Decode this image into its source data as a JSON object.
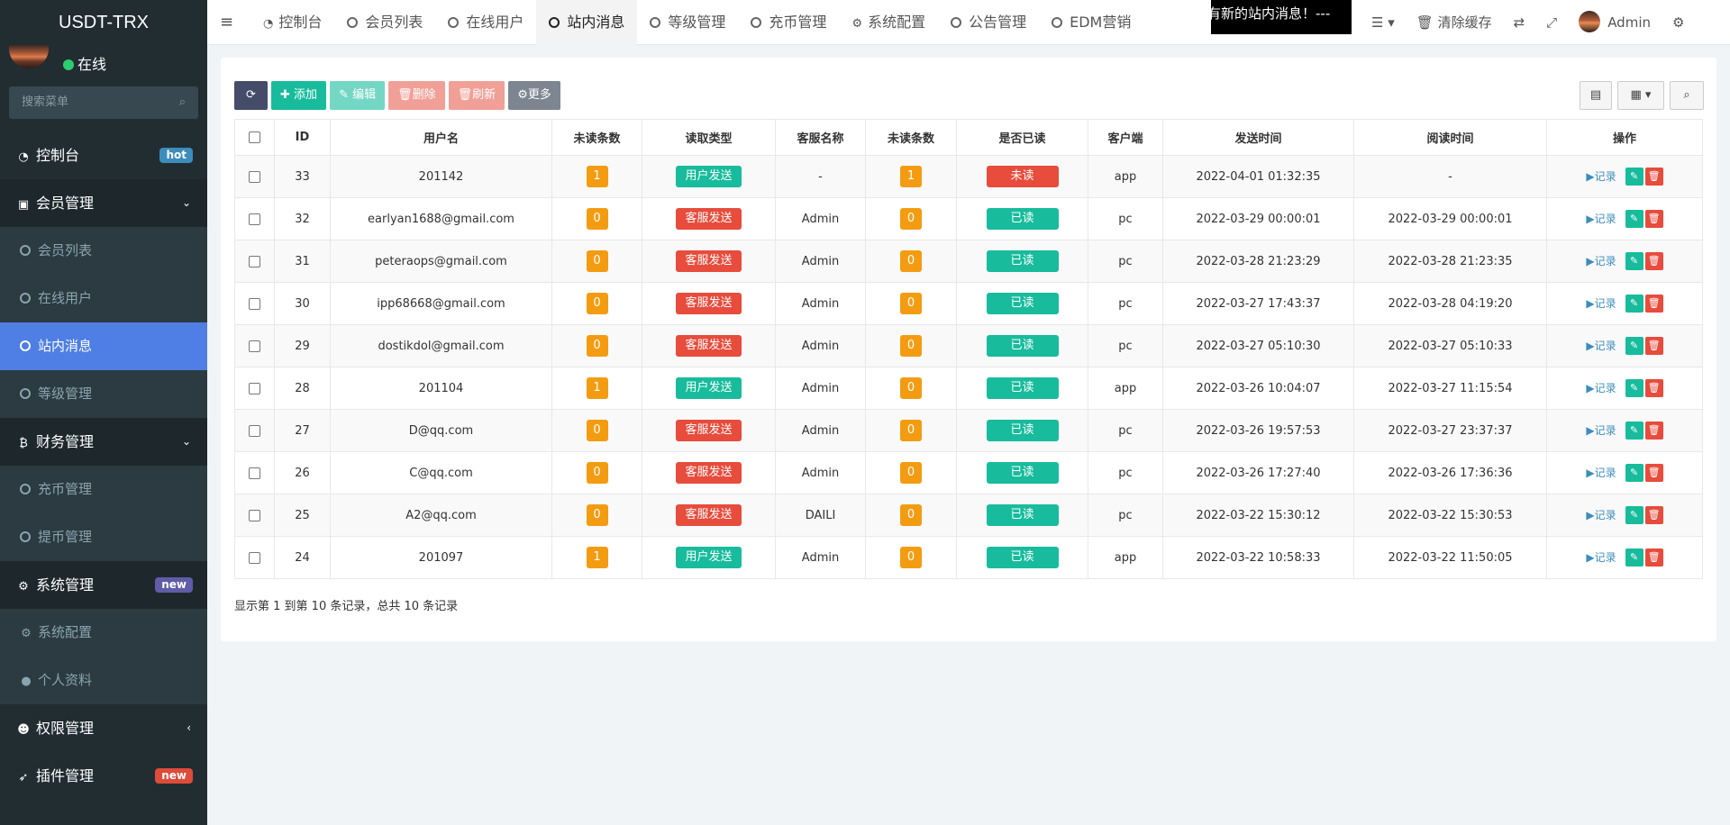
{
  "brand": "USDT-TRX",
  "user": {
    "status": "在线"
  },
  "search": {
    "placeholder": "搜索菜单",
    "icon": "search-icon"
  },
  "sidebar": {
    "dashboard": {
      "label": "控制台",
      "badge": "hot"
    },
    "member": {
      "label": "会员管理",
      "items": [
        "会员列表",
        "在线用户",
        "站内消息",
        "等级管理"
      ]
    },
    "finance": {
      "label": "财务管理",
      "items": [
        "充币管理",
        "提币管理"
      ]
    },
    "system": {
      "label": "系统管理",
      "badge": "new",
      "items": [
        "系统配置",
        "个人资料"
      ]
    },
    "permission": {
      "label": "权限管理"
    },
    "plugin": {
      "label": "插件管理",
      "badge": "new"
    }
  },
  "tabs": [
    "控制台",
    "会员列表",
    "在线用户",
    "站内消息",
    "等级管理",
    "充币管理",
    "系统配置",
    "公告管理",
    "EDM营销"
  ],
  "active_tab": "站内消息",
  "marquee": "有新的站内消息！---",
  "topbar": {
    "clear_cache": "清除缓存",
    "admin": "Admin"
  },
  "toolbar": {
    "add": "添加",
    "edit": "编辑",
    "delete": "删除",
    "refresh": "刷新",
    "more": "更多"
  },
  "table": {
    "headers": [
      "ID",
      "用户名",
      "未读条数",
      "读取类型",
      "客服名称",
      "未读条数",
      "是否已读",
      "客户端",
      "发送时间",
      "阅读时间",
      "操作"
    ],
    "rows": [
      [
        "33",
        "201142",
        "1",
        "用户发送",
        "-",
        "1",
        "未读",
        "app",
        "2022-04-01 01:32:35",
        "-"
      ],
      [
        "32",
        "earlyan1688@gmail.com",
        "0",
        "客服发送",
        "Admin",
        "0",
        "已读",
        "pc",
        "2022-03-29 00:00:01",
        "2022-03-29 00:00:01"
      ],
      [
        "31",
        "peteraops@gmail.com",
        "0",
        "客服发送",
        "Admin",
        "0",
        "已读",
        "pc",
        "2022-03-28 21:23:29",
        "2022-03-28 21:23:35"
      ],
      [
        "30",
        "ipp68668@gmail.com",
        "0",
        "客服发送",
        "Admin",
        "0",
        "已读",
        "pc",
        "2022-03-27 17:43:37",
        "2022-03-28 04:19:20"
      ],
      [
        "29",
        "dostikdol@gmail.com",
        "0",
        "客服发送",
        "Admin",
        "0",
        "已读",
        "pc",
        "2022-03-27 05:10:30",
        "2022-03-27 05:10:33"
      ],
      [
        "28",
        "201104",
        "1",
        "用户发送",
        "Admin",
        "0",
        "已读",
        "app",
        "2022-03-26 10:04:07",
        "2022-03-27 11:15:54"
      ],
      [
        "27",
        "D@qq.com",
        "0",
        "客服发送",
        "Admin",
        "0",
        "已读",
        "pc",
        "2022-03-26 19:57:53",
        "2022-03-27 23:37:37"
      ],
      [
        "26",
        "C@qq.com",
        "0",
        "客服发送",
        "Admin",
        "0",
        "已读",
        "pc",
        "2022-03-26 17:27:40",
        "2022-03-26 17:36:36"
      ],
      [
        "25",
        "A2@qq.com",
        "0",
        "客服发送",
        "DAILI",
        "0",
        "已读",
        "pc",
        "2022-03-22 15:30:12",
        "2022-03-22 15:30:53"
      ],
      [
        "24",
        "201097",
        "1",
        "用户发送",
        "Admin",
        "0",
        "已读",
        "app",
        "2022-03-22 10:58:33",
        "2022-03-22 11:50:05"
      ]
    ],
    "op_label": "记录"
  },
  "pagination": "显示第 1 到第 10 条记录，总共 10 条记录",
  "colors": {
    "sidebar": "#222d32",
    "active": "#4f7ee5",
    "green": "#18bc9c",
    "red": "#e74c3c",
    "orange": "#f39c12"
  }
}
